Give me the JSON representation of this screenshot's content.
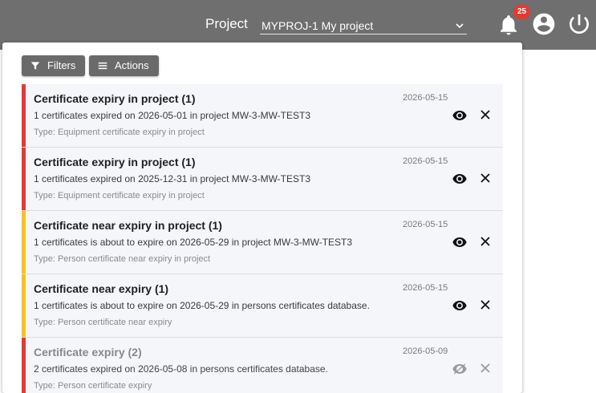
{
  "header": {
    "project_label": "Project",
    "project_value": "MYPROJ-1 My project",
    "notification_count": "25"
  },
  "toolbar": {
    "filters_label": "Filters",
    "actions_label": "Actions"
  },
  "notifications": [
    {
      "title": "Certificate expiry in project (1)",
      "date": "2026-05-15",
      "description": "1 certificates expired on 2026-05-01 in project MW-3-MW-TEST3",
      "type": "Type: Equipment certificate expiry in project",
      "severity_color": "#e53935"
    },
    {
      "title": "Certificate expiry in project (1)",
      "date": "2026-05-15",
      "description": "1 certificates expired on 2025-12-31 in project MW-3-MW-TEST3",
      "type": "Type: Equipment certificate expiry in project",
      "severity_color": "#e53935"
    },
    {
      "title": "Certificate near expiry in project (1)",
      "date": "2026-05-15",
      "description": "1 certificates is about to expire on 2026-05-29 in project MW-3-MW-TEST3",
      "type": "Type: Person certificate near expiry in project",
      "severity_color": "#f9c023"
    },
    {
      "title": "Certificate near expiry (1)",
      "date": "2026-05-15",
      "description": "1 certificates is about to expire on 2026-05-29 in persons certificates database.",
      "type": "Type: Person certificate near expiry",
      "severity_color": "#f9c023"
    },
    {
      "title": "Certificate expiry (2)",
      "date": "2026-05-09",
      "description": "2 certificates expired on 2026-05-08 in persons certificates database.",
      "type": "Type: Person certificate expiry",
      "severity_color": "#e53935"
    }
  ]
}
